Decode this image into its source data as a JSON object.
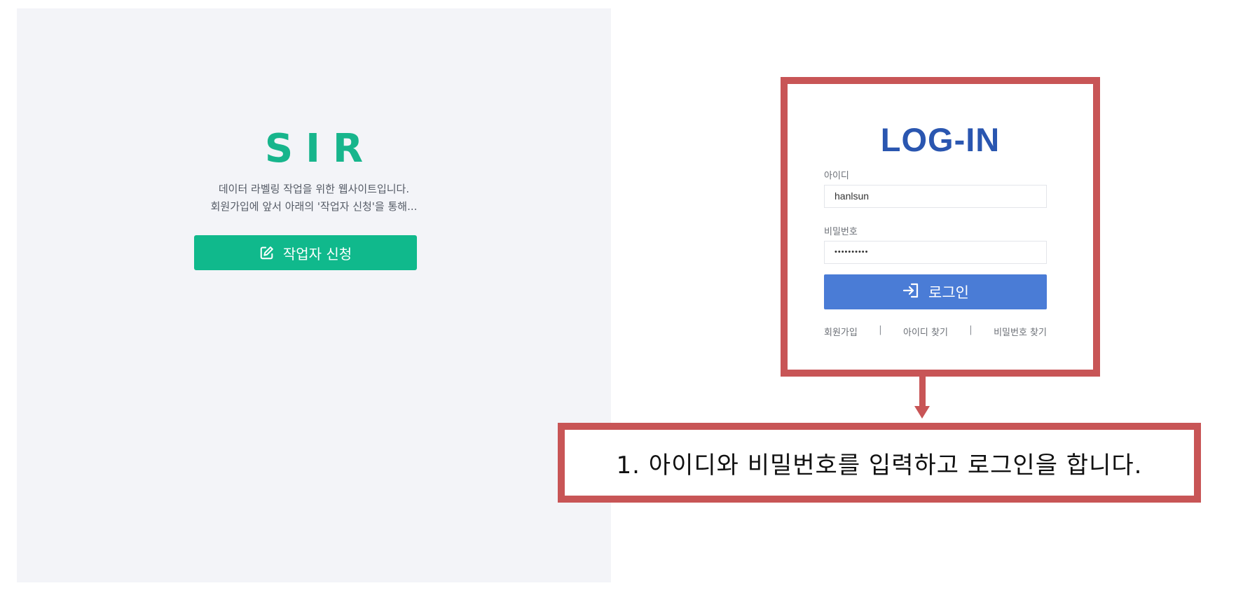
{
  "left_panel": {
    "brand": "SIR",
    "intro_line1": "데이터 라벨링 작업을 위한 웹사이트입니다.",
    "intro_line2": "회원가입에 앞서 아래의 '작업자 신청'을 통해...",
    "apply_button": {
      "label": "작업자 신청",
      "icon": "edit-icon"
    }
  },
  "login": {
    "title": "LOG-IN",
    "id_label": "아이디",
    "id_value": "hanlsun",
    "password_label": "비밀번호",
    "password_value": "••••••••••",
    "login_button": {
      "label": "로그인",
      "icon": "sign-in-icon"
    },
    "links": {
      "signup": "회원가입",
      "find_id": "아이디 찾기",
      "find_password": "비밀번호 찾기",
      "separator": "|"
    }
  },
  "annotation": {
    "instruction": "1. 아이디와 비밀번호를 입력하고 로그인을 합니다.",
    "highlight_color": "#c85556"
  },
  "colors": {
    "brand_green": "#10b98c",
    "login_blue": "#4a7cd6",
    "title_blue": "#2a56b0",
    "panel_bg": "#f3f4f8"
  }
}
